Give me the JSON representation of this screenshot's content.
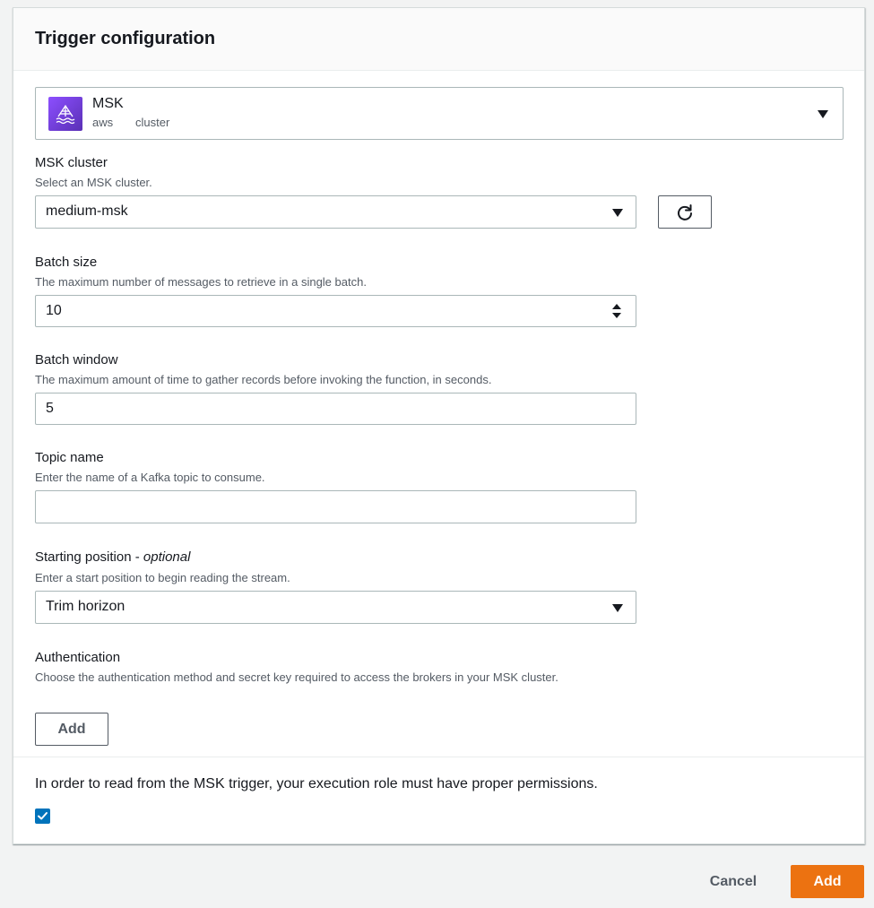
{
  "panel": {
    "title": "Trigger configuration"
  },
  "service": {
    "name": "MSK",
    "tags": [
      "aws",
      "cluster"
    ],
    "icon": "msk-service-icon",
    "icon_color": "#7b42e0"
  },
  "msk_cluster": {
    "label": "MSK cluster",
    "description": "Select an MSK cluster.",
    "value": "medium-msk"
  },
  "batch_size": {
    "label": "Batch size",
    "description": "The maximum number of messages to retrieve in a single batch.",
    "value": "10"
  },
  "batch_window": {
    "label": "Batch window",
    "description": "The maximum amount of time to gather records before invoking the function, in seconds.",
    "value": "5"
  },
  "topic_name": {
    "label": "Topic name",
    "description": "Enter the name of a Kafka topic to consume.",
    "value": ""
  },
  "starting_position": {
    "label": "Starting position - ",
    "label_optional": "optional",
    "description": "Enter a start position to begin reading the stream.",
    "value": "Trim horizon"
  },
  "authentication": {
    "label": "Authentication",
    "description": "Choose the authentication method and secret key required to access the brokers in your MSK cluster.",
    "add_label": "Add"
  },
  "permissions": {
    "text": "In order to read from the MSK trigger, your execution role must have proper permissions.",
    "checked": true
  },
  "footer": {
    "cancel_label": "Cancel",
    "add_label": "Add"
  },
  "colors": {
    "primary": "#ec7211",
    "checkbox": "#0073bb",
    "border": "#aab7b8"
  }
}
